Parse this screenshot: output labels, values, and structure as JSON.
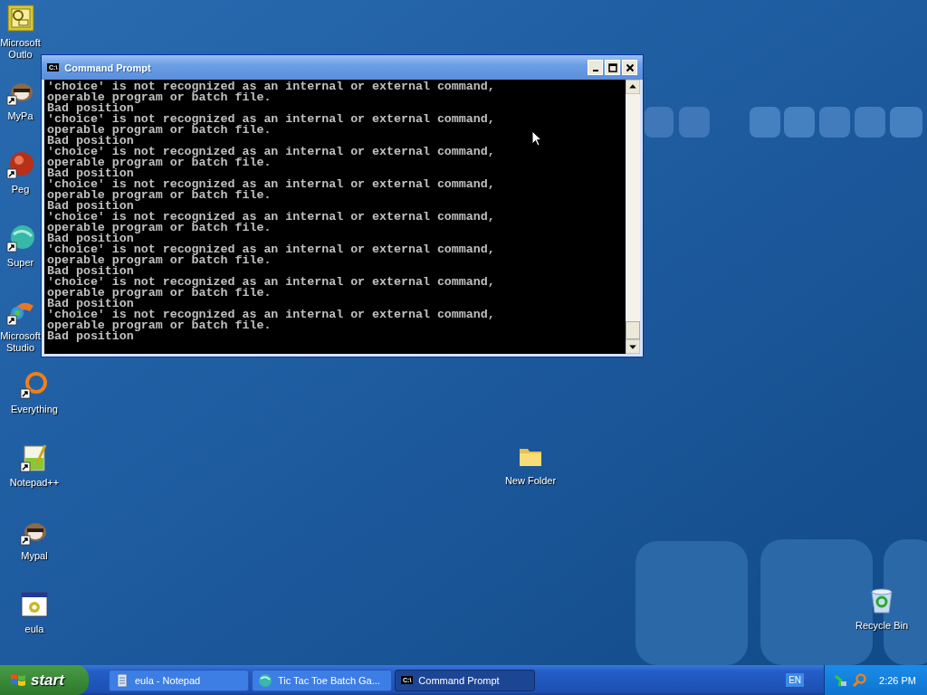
{
  "desktop_icons": [
    {
      "label": "Microsoft Outlo",
      "kind": "outlook",
      "shortcut": false
    },
    {
      "label": "MyPa",
      "kind": "raccoon",
      "shortcut": true
    },
    {
      "label": "Peg",
      "kind": "ball",
      "shortcut": true
    },
    {
      "label": "Super",
      "kind": "brain",
      "shortcut": true
    },
    {
      "label": "Microsoft Studio",
      "kind": "studio",
      "shortcut": true
    },
    {
      "label": "Everything",
      "kind": "ring",
      "shortcut": true
    },
    {
      "label": "Notepad++",
      "kind": "notepad",
      "shortcut": true
    },
    {
      "label": "Mypal",
      "kind": "raccoon",
      "shortcut": true
    },
    {
      "label": "eula",
      "kind": "app",
      "shortcut": false
    }
  ],
  "free_icons": [
    {
      "label": "New Folder",
      "kind": "folder"
    },
    {
      "label": "Recycle Bin",
      "kind": "recycle"
    }
  ],
  "window": {
    "title": "Command Prompt",
    "title_icon": "C:\\",
    "lines": [
      "'choice' is not recognized as an internal or external command,",
      "operable program or batch file.",
      "Bad position",
      "'choice' is not recognized as an internal or external command,",
      "operable program or batch file.",
      "Bad position",
      "'choice' is not recognized as an internal or external command,",
      "operable program or batch file.",
      "Bad position",
      "'choice' is not recognized as an internal or external command,",
      "operable program or batch file.",
      "Bad position",
      "'choice' is not recognized as an internal or external command,",
      "operable program or batch file.",
      "Bad position",
      "'choice' is not recognized as an internal or external command,",
      "operable program or batch file.",
      "Bad position",
      "'choice' is not recognized as an internal or external command,",
      "operable program or batch file.",
      "Bad position",
      "'choice' is not recognized as an internal or external command,",
      "operable program or batch file.",
      "Bad position"
    ]
  },
  "taskbar": {
    "start": "start",
    "tasks": [
      {
        "label": "eula - Notepad",
        "kind": "notepad",
        "selected": false
      },
      {
        "label": "Tic Tac Toe Batch Ga...",
        "kind": "game",
        "selected": false
      },
      {
        "label": "Command Prompt",
        "kind": "cmd",
        "icon_text": "C:\\",
        "selected": true
      }
    ],
    "language": "EN",
    "clock": "2:26 PM"
  }
}
